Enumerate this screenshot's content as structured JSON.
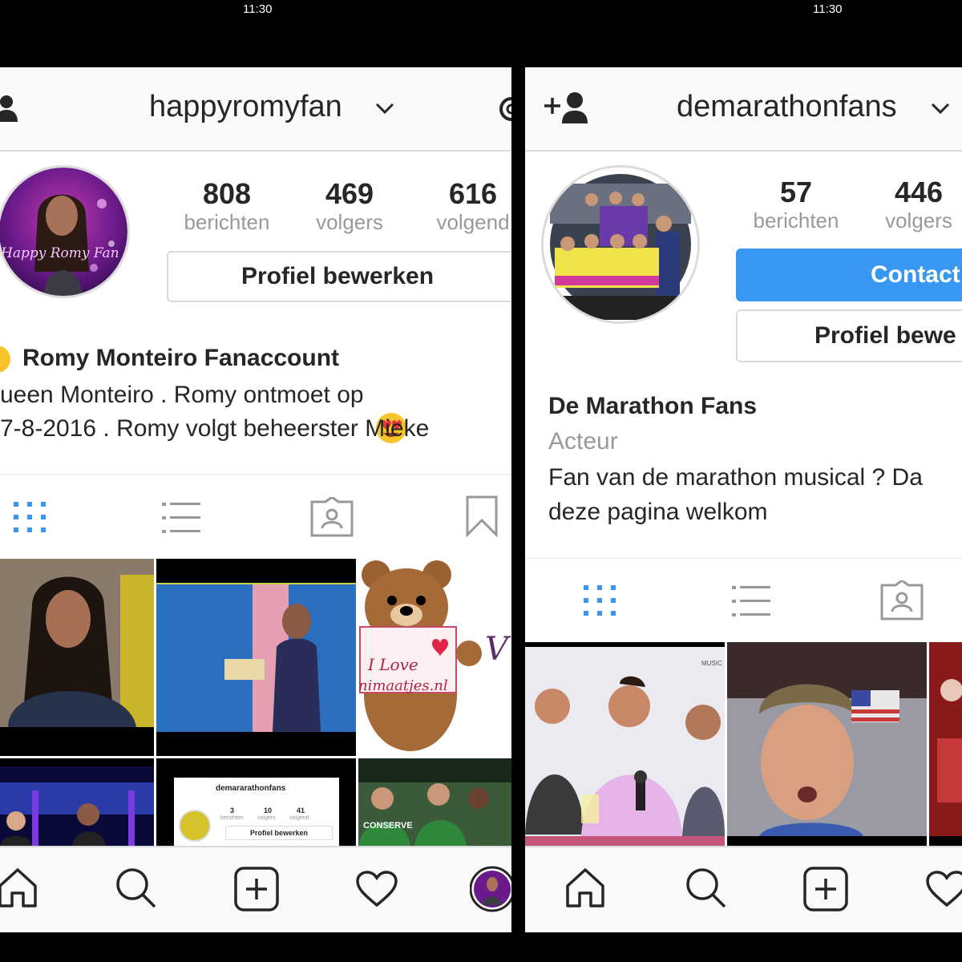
{
  "left": {
    "status_time": "11:30",
    "username": "happyromyfan",
    "stats": [
      {
        "num": "808",
        "label": "berichten"
      },
      {
        "num": "469",
        "label": "volgers"
      },
      {
        "num": "616",
        "label": "volgend"
      }
    ],
    "edit_button": "Profiel bewerken",
    "bio_name": "Romy Monteiro Fanaccount",
    "bio_line1": "ueen Monteiro . Romy ontmoet op",
    "bio_line2": "7-8-2016 . Romy volgt beheerster Mieke",
    "avatar_text": "Happy Romy Fan",
    "grid_texts": {
      "bear_line1": "I Love",
      "bear_line2": "nimaatjes.nl",
      "bear_side": "V",
      "mini_username": "demararathonfans",
      "mini_stats": [
        {
          "num": "3",
          "label": "berichten"
        },
        {
          "num": "10",
          "label": "volgers"
        },
        {
          "num": "41",
          "label": "volgend"
        }
      ],
      "mini_button": "Profiel bewerken",
      "shirt_text": "CONSERVE"
    }
  },
  "right": {
    "status_time": "11:30",
    "username": "demarathonfans",
    "stats": [
      {
        "num": "57",
        "label": "berichten"
      },
      {
        "num": "446",
        "label": "volgers"
      }
    ],
    "contact_button": "Contact",
    "edit_button": "Profiel bewe",
    "bio_name": "De Marathon Fans",
    "category": "Acteur",
    "bio_line1": "Fan van de marathon musical ? Da",
    "bio_line2": "deze pagina welkom",
    "grid_texts": {
      "music_tag": "MUSIC"
    }
  },
  "colors": {
    "accent": "#3897f0",
    "border": "#dbdbdb",
    "gray_text": "#999999"
  }
}
